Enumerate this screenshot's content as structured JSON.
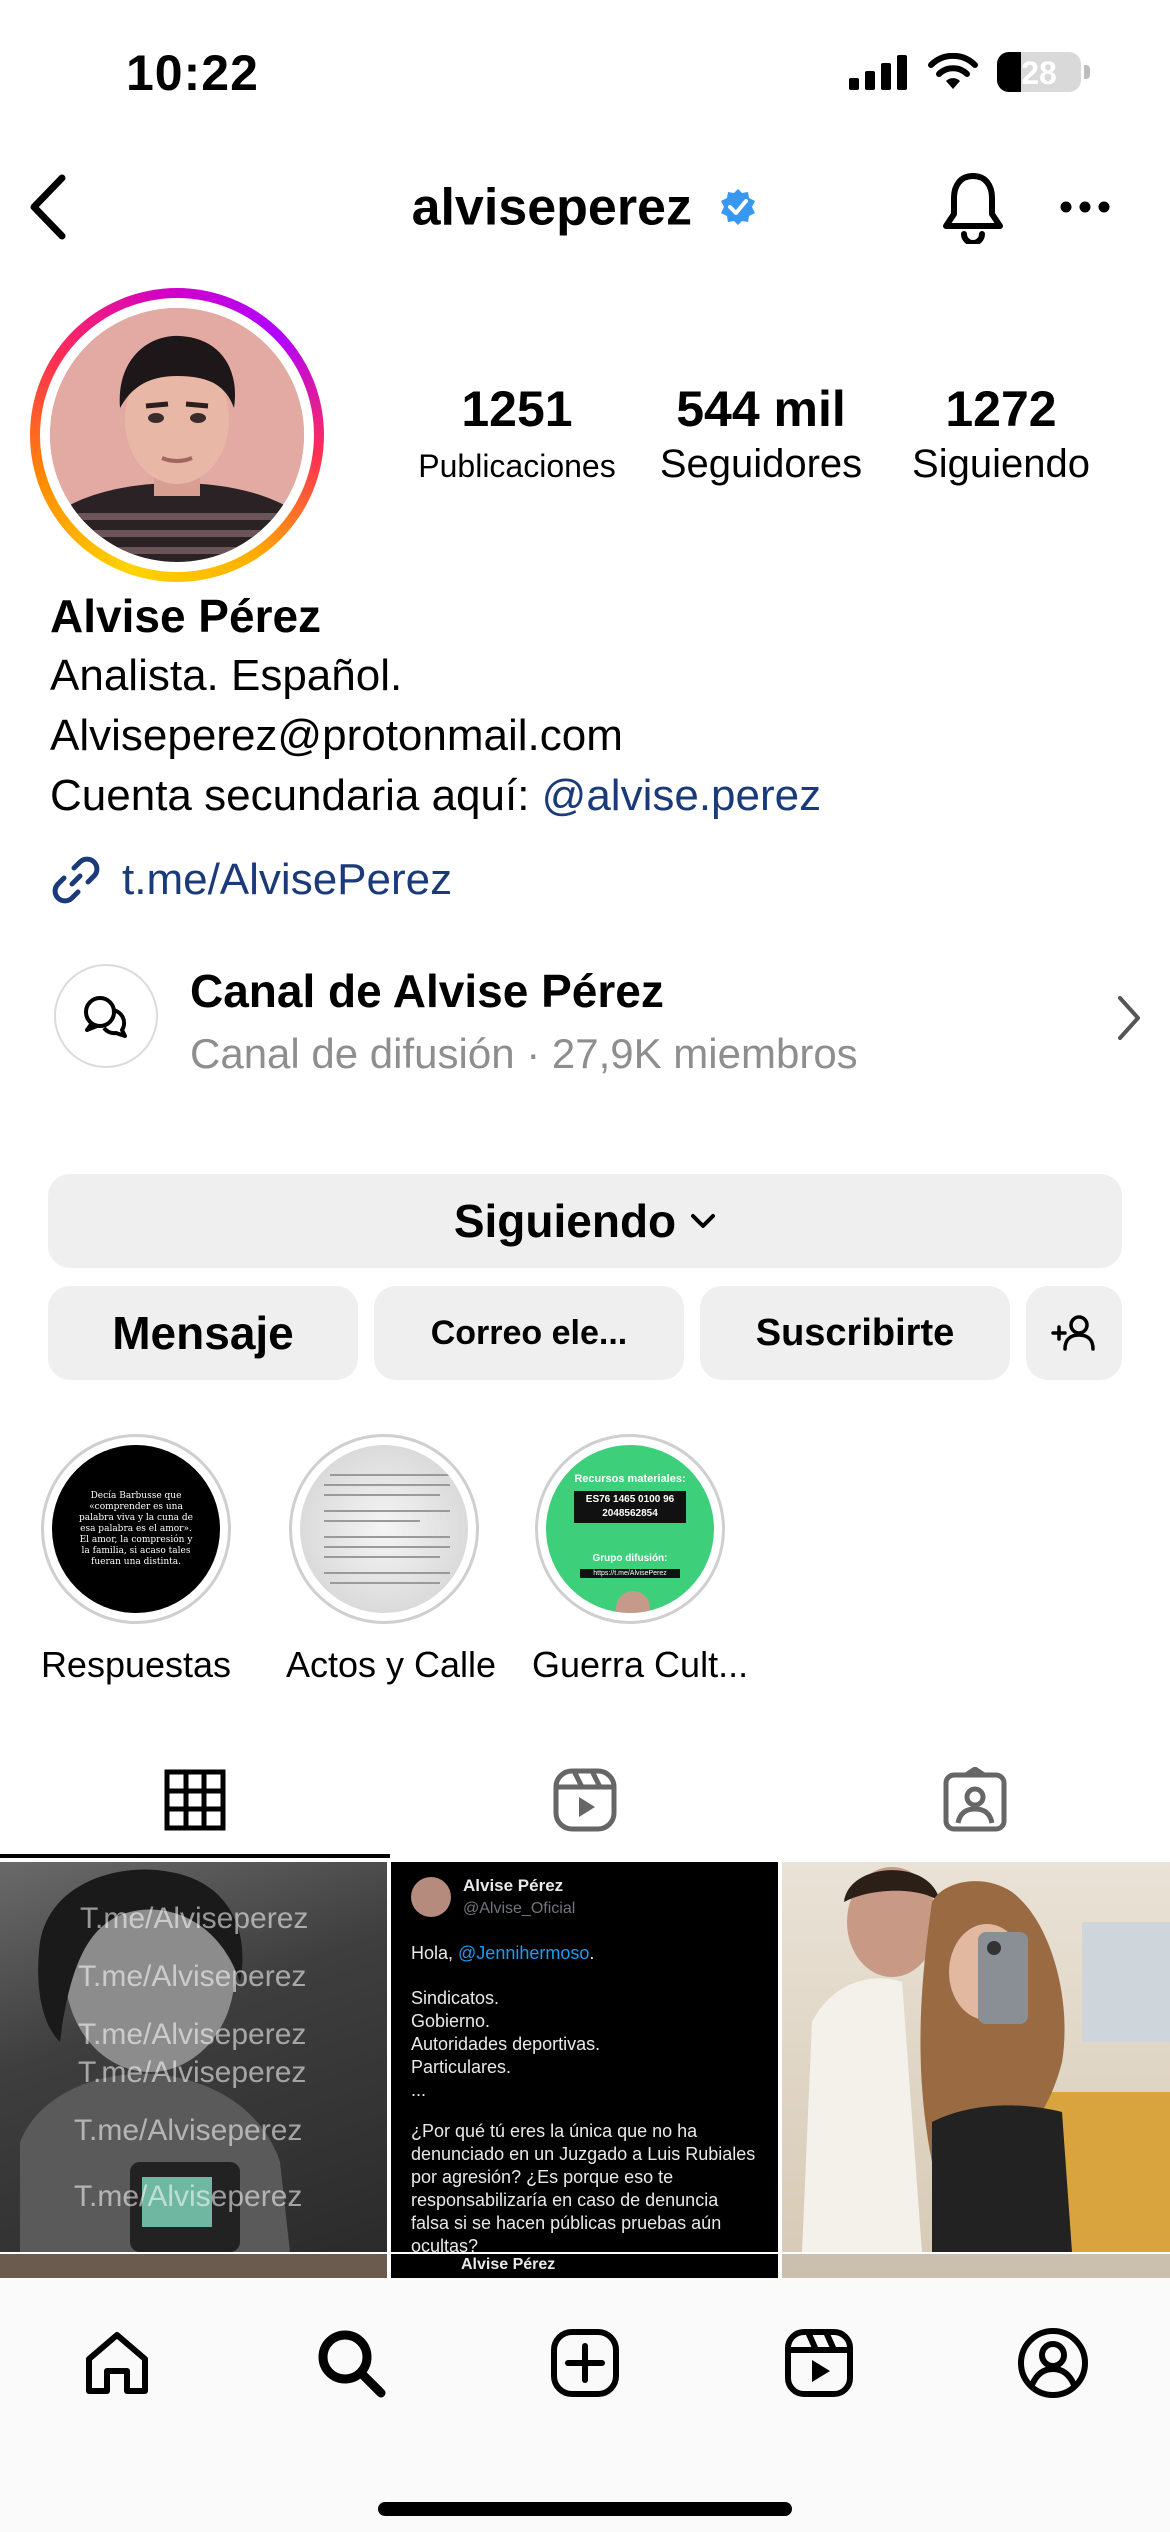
{
  "status_bar": {
    "time": "10:22",
    "battery": "28"
  },
  "header": {
    "username": "alviseperez"
  },
  "stats": [
    {
      "value": "1251",
      "label": "Publicaciones"
    },
    {
      "value": "544 mil",
      "label": "Seguidores"
    },
    {
      "value": "1272",
      "label": "Siguiendo"
    }
  ],
  "bio": {
    "name": "Alvise Pérez",
    "line1": "Analista. Español.",
    "line2": "Alviseperez@protonmail.com",
    "line3_prefix": "Cuenta secundaria aquí: ",
    "line3_mention": "@alvise.perez",
    "link": "t.me/AlvisePerez"
  },
  "channel": {
    "title": "Canal de Alvise Pérez",
    "subtitle": "Canal de difusión · 27,9K miembros"
  },
  "buttons": {
    "following": "Siguiendo",
    "message": "Mensaje",
    "email": "Correo ele...",
    "subscribe": "Suscribirte"
  },
  "highlights": [
    {
      "label": "Respuestas",
      "cover_text": "Decía Barbusse que «comprender es una palabra viva y la cuna de esa palabra es el amor». El amor, la compresión y la familia, si acaso tales fueran una distinta."
    },
    {
      "label": "Actos y Calle",
      "cover_text": ""
    },
    {
      "label": "Guerra Cult...",
      "cover_title": "Recursos materiales:",
      "cover_iban": "ES76 1465 0100 96 2048562854",
      "cover_sub": "Grupo difusión:",
      "cover_url": "https://t.me/AlvisePerez"
    }
  ],
  "posts": {
    "watermark": "T.me/Alviseperez",
    "tweet": {
      "name": "Alvise Pérez",
      "handle": "@Alvise_Oficial",
      "greeting_prefix": "Hola, ",
      "greeting_mention": "@Jennihermoso",
      "greeting_suffix": ".",
      "list": [
        "Sindicatos.",
        "Gobierno.",
        "Autoridades deportivas.",
        "Particulares.",
        "..."
      ],
      "question": "¿Por qué tú eres la única que no ha denunciado en un Juzgado a Luis Rubiales por agresión? ¿Es porque eso te responsabilizaría en caso de denuncia falsa si se hacen públicas pruebas aún ocultas?"
    },
    "next_row_name": "Alvise Pérez"
  }
}
